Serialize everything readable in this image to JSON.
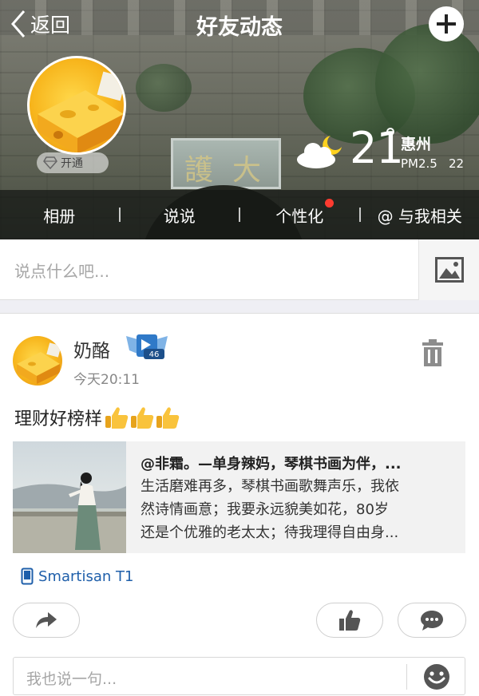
{
  "header": {
    "back_label": "返回",
    "title": "好友动态",
    "add_icon": "plus-circle-icon",
    "vip_label": "开通",
    "weather": {
      "icon": "cloud-moon-icon",
      "temperature": "21",
      "city": "惠州",
      "pm_label": "PM2.5",
      "pm_value": "22"
    },
    "plaque_text": "护大",
    "tabs": [
      {
        "label": "相册"
      },
      {
        "label": "说说"
      },
      {
        "label": "个性化",
        "has_badge": true
      },
      {
        "label": "@ 与我相关"
      }
    ]
  },
  "compose": {
    "placeholder": "说点什么吧...",
    "photo_icon": "image-icon"
  },
  "post": {
    "username": "奶酪",
    "level_badge": "46",
    "time": "今天20:11",
    "text": "理财好榜样",
    "emoji": [
      "thumbs-up",
      "thumbs-up",
      "thumbs-up"
    ],
    "shared": {
      "title": "@非霜。—单身辣妈，琴棋书画为伴，...",
      "lines": [
        "生活磨难再多，琴棋书画歌舞声乐，我依",
        "然诗情画意；我要永远貌美如花，80岁",
        "还是个优雅的老太太；待我理得自由身..."
      ]
    },
    "device": "Smartisan T1",
    "reply_placeholder": "我也说一句..."
  },
  "colors": {
    "link_blue": "#1f5faa",
    "badge_red": "#ff3b30",
    "placeholder_gray": "#a6a6a6"
  }
}
